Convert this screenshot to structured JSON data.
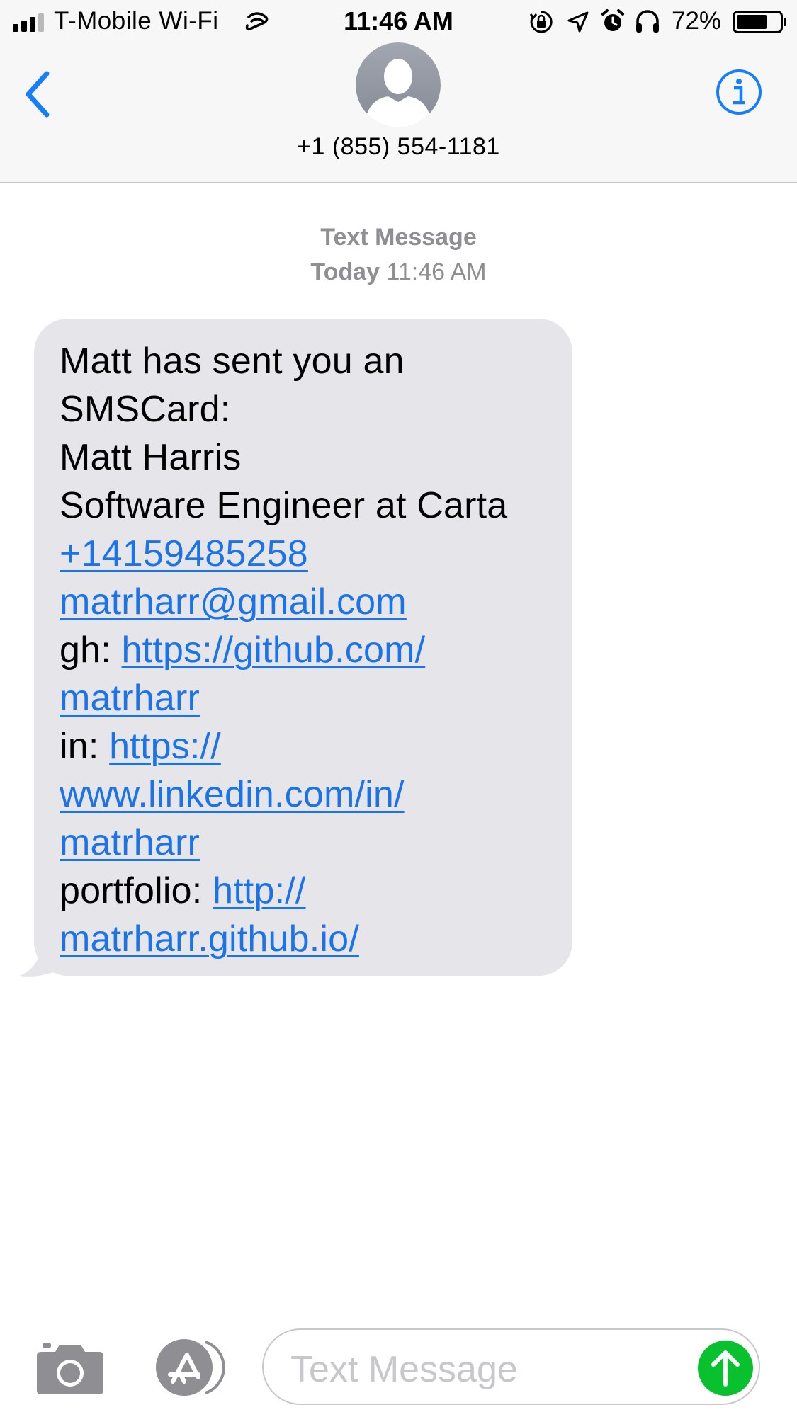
{
  "status_bar": {
    "carrier": "T-Mobile Wi-Fi",
    "time": "11:46 AM",
    "battery_percent": "72%",
    "battery_level": 0.72,
    "icons": [
      "signal-icon",
      "wifi-calling-icon",
      "orientation-lock-icon",
      "location-icon",
      "alarm-icon",
      "headphones-icon",
      "battery-icon"
    ]
  },
  "header": {
    "contact": "+1 (855) 554-1181",
    "back_icon": "chevron-left-icon",
    "info_icon": "info-icon",
    "avatar_icon": "person-silhouette-icon"
  },
  "conversation": {
    "service_label": "Text Message",
    "timestamp_day": "Today",
    "timestamp_time": "11:46 AM",
    "message": {
      "line1": "Matt has sent you an",
      "line2": "SMSCard:",
      "line3": "Matt Harris",
      "line4": "Software Engineer at Carta",
      "phone_link": "+14159485258",
      "email_link": "matrharr@gmail.com",
      "gh_label": "gh: ",
      "gh_link_1": "https://github.com/",
      "gh_link_2": "matrharr",
      "in_label": "in: ",
      "in_link_1": "https://",
      "in_link_2": "www.linkedin.com/in/",
      "in_link_3": "matrharr",
      "portfolio_label": "portfolio: ",
      "portfolio_link_1": "http://",
      "portfolio_link_2": "matrharr.github.io/"
    }
  },
  "input_bar": {
    "placeholder": "Text Message",
    "camera_icon": "camera-icon",
    "apps_icon": "app-store-icon",
    "send_icon": "send-arrow-icon"
  },
  "colors": {
    "accent": "#157efb",
    "bubble": "#e5e5ea",
    "link": "#1a73e8",
    "send": "#09c12e",
    "meta": "#8e8e93",
    "bar_background": "#f7f7f7"
  }
}
